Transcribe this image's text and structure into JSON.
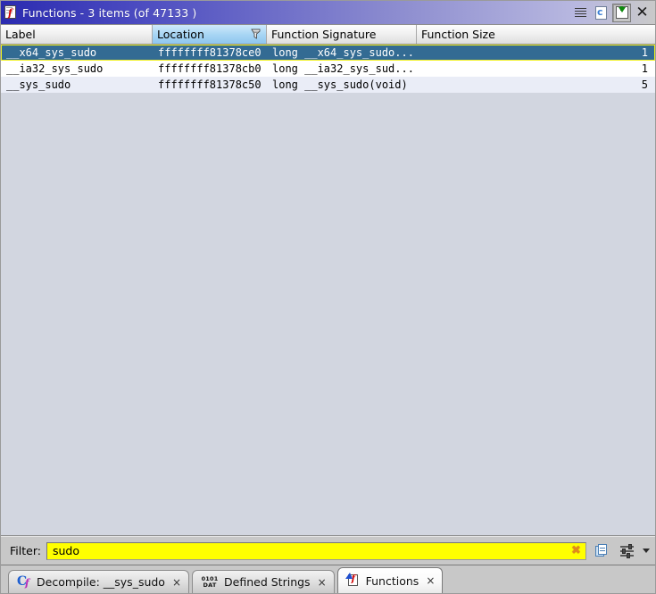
{
  "window": {
    "title": "Functions - 3 items (of 47133 )",
    "icon": "functions-window-icon",
    "buttons": [
      {
        "name": "menu-lines-icon",
        "label": ""
      },
      {
        "name": "copy-page-icon",
        "label": ""
      },
      {
        "name": "snapshot-icon",
        "label": ""
      },
      {
        "name": "close-icon",
        "label": "✕"
      }
    ]
  },
  "table": {
    "columns": [
      {
        "label": "Label",
        "sorted": false
      },
      {
        "label": "Location",
        "sorted": true
      },
      {
        "label": "Function Signature",
        "sorted": false
      },
      {
        "label": "Function Size",
        "sorted": false
      }
    ],
    "rows": [
      {
        "label": "__x64_sys_sudo",
        "location": "ffffffff81378ce0",
        "signature": "long __x64_sys_sudo...",
        "size": "1",
        "selected": true
      },
      {
        "label": "__ia32_sys_sudo",
        "location": "ffffffff81378cb0",
        "signature": "long __ia32_sys_sud...",
        "size": "1",
        "selected": false
      },
      {
        "label": "__sys_sudo",
        "location": "ffffffff81378c50",
        "signature": "long __sys_sudo(void)",
        "size": "5",
        "selected": false
      }
    ]
  },
  "filter": {
    "label": "Filter:",
    "value": "sudo",
    "placeholder": "",
    "clear_icon": "✖",
    "buttons": [
      {
        "name": "copy-filter-icon"
      },
      {
        "name": "filter-options-icon"
      }
    ]
  },
  "tabs": [
    {
      "label": "Decompile: __sys_sudo",
      "icon": "c-decompiler-icon",
      "close": "×",
      "active": false
    },
    {
      "label": "Defined Strings",
      "icon": "data-strings-icon",
      "close": "×",
      "active": false
    },
    {
      "label": "Functions",
      "icon": "functions-icon",
      "close": "×",
      "active": true
    }
  ],
  "colors": {
    "selection": "#336b93",
    "focus_outline": "#f2f21e",
    "filter_field": "#ffff00",
    "sorted_header": "#a9d6f4",
    "empty_area": "#d2d6e0"
  }
}
